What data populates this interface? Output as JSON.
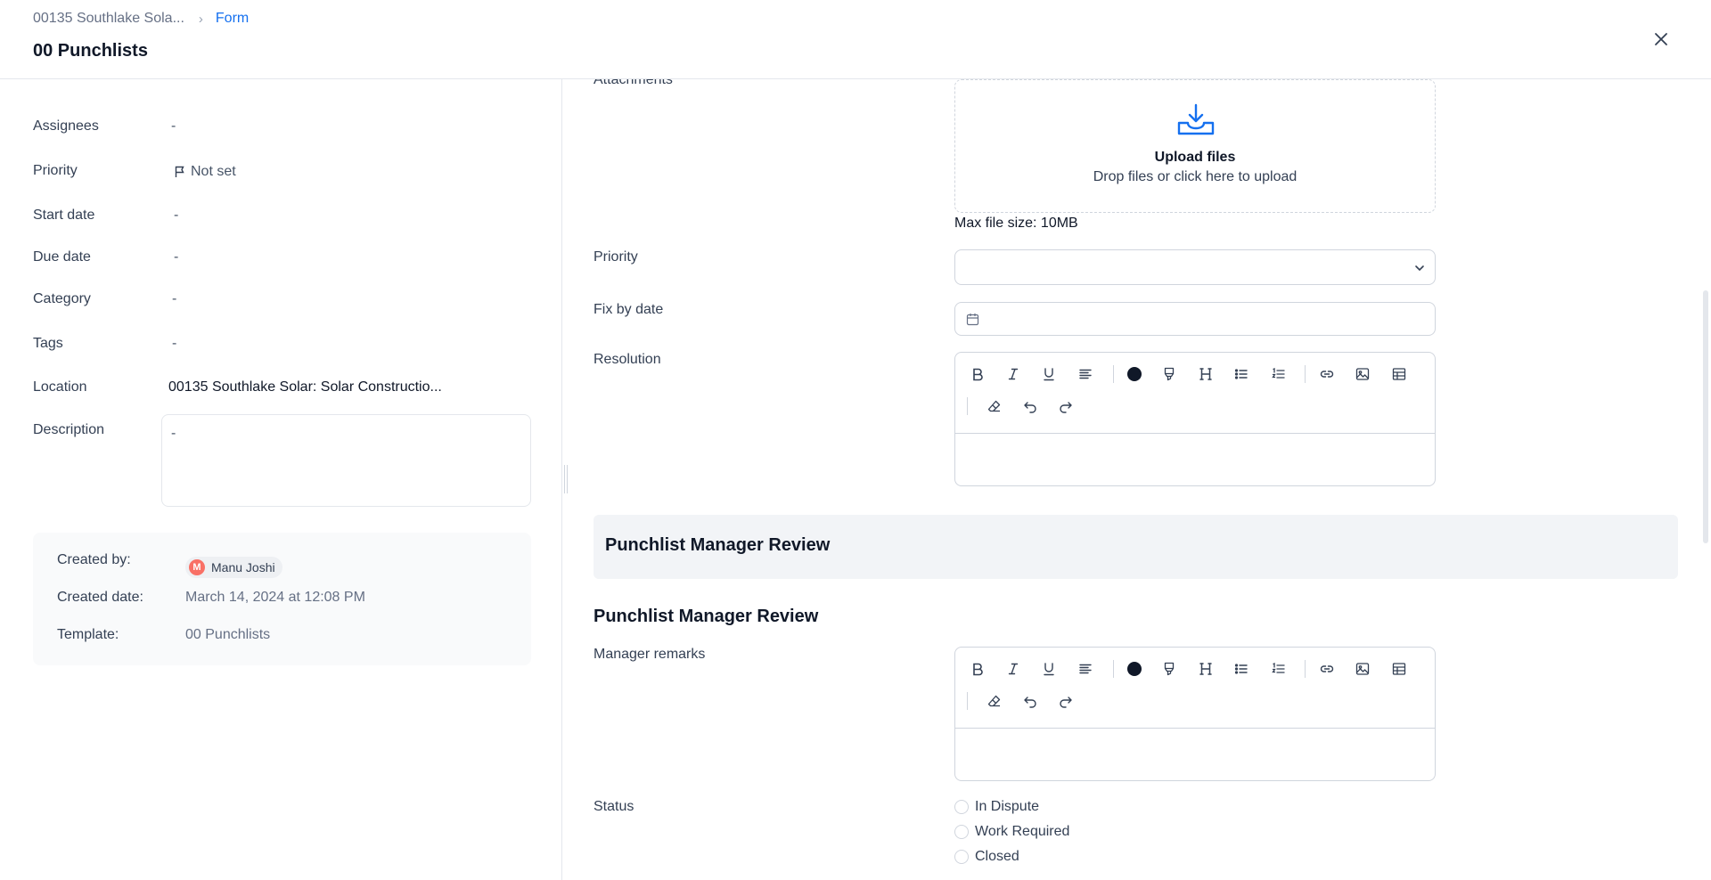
{
  "header": {
    "breadcrumb_project": "00135 Southlake Sola...",
    "breadcrumb_current": "Form",
    "title": "00 Punchlists"
  },
  "details": {
    "assignees_label": "Assignees",
    "assignees_value": "-",
    "priority_label": "Priority",
    "priority_value": "Not set",
    "start_date_label": "Start date",
    "start_date_value": "-",
    "due_date_label": "Due date",
    "due_date_value": "-",
    "category_label": "Category",
    "category_value": "-",
    "tags_label": "Tags",
    "tags_value": "-",
    "location_label": "Location",
    "location_value": "00135 Southlake Solar: Solar Constructio...",
    "description_label": "Description",
    "description_value": "-"
  },
  "meta": {
    "created_by_label": "Created by:",
    "created_by_initial": "M",
    "created_by_name": "Manu Joshi",
    "created_date_label": "Created date:",
    "created_date_value": "March 14, 2024 at 12:08 PM",
    "template_label": "Template:",
    "template_value": "00 Punchlists"
  },
  "form": {
    "attachments_label": "Attachments",
    "upload_title": "Upload files",
    "upload_hint": "Drop files or click here to upload",
    "max_file_size": "Max file size: 10MB",
    "priority_label": "Priority",
    "fix_by_date_label": "Fix by date",
    "resolution_label": "Resolution",
    "section_bar_title": "Punchlist Manager Review",
    "section_heading": "Punchlist Manager Review",
    "manager_remarks_label": "Manager remarks",
    "status_label": "Status",
    "status_options": [
      "In Dispute",
      "Work Required",
      "Closed"
    ]
  },
  "colors": {
    "accent": "#1570ef",
    "avatar": "#f97066",
    "section_bg": "#f2f4f7",
    "meta_bg": "#f9fafb"
  }
}
